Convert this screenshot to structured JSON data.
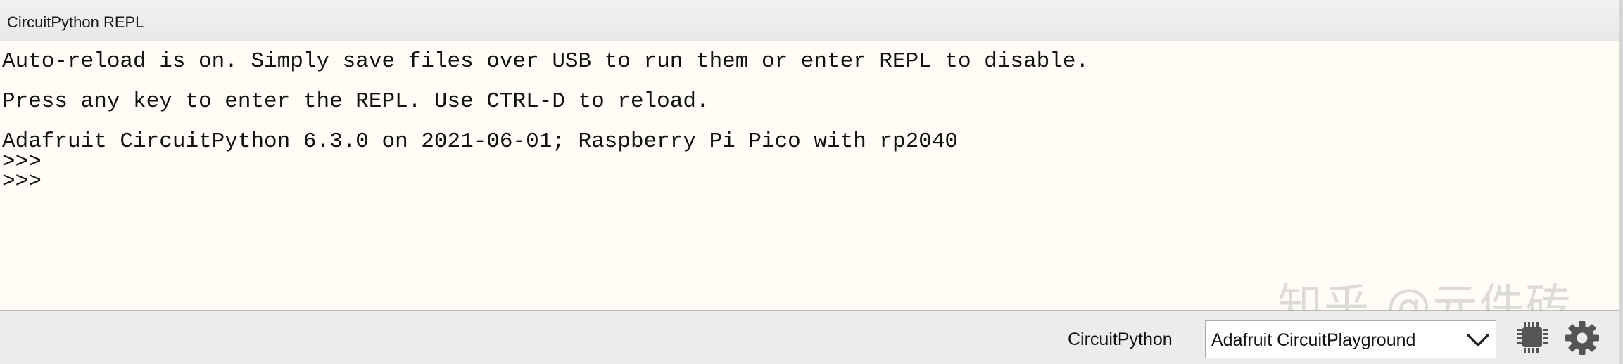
{
  "window": {
    "title": "CircuitPython REPL"
  },
  "console": {
    "lines": [
      "Auto-reload is on. Simply save files over USB to run them or enter REPL to disable.",
      "",
      "Press any key to enter the REPL. Use CTRL-D to reload.",
      "",
      "Adafruit CircuitPython 6.3.0 on 2021-06-01; Raspberry Pi Pico with rp2040",
      ">>>",
      ">>>"
    ]
  },
  "watermark": {
    "text": "知乎 @元件砖"
  },
  "status_bar": {
    "mode_label": "CircuitPython",
    "board_select": {
      "selected": "Adafruit CircuitPlayground"
    },
    "icons": [
      "chip-icon",
      "gear-icon",
      "chevron-down-icon"
    ]
  },
  "colors": {
    "console_background": "#fffdf6",
    "chrome_background": "#ececec",
    "icon_gray": "#555555"
  }
}
